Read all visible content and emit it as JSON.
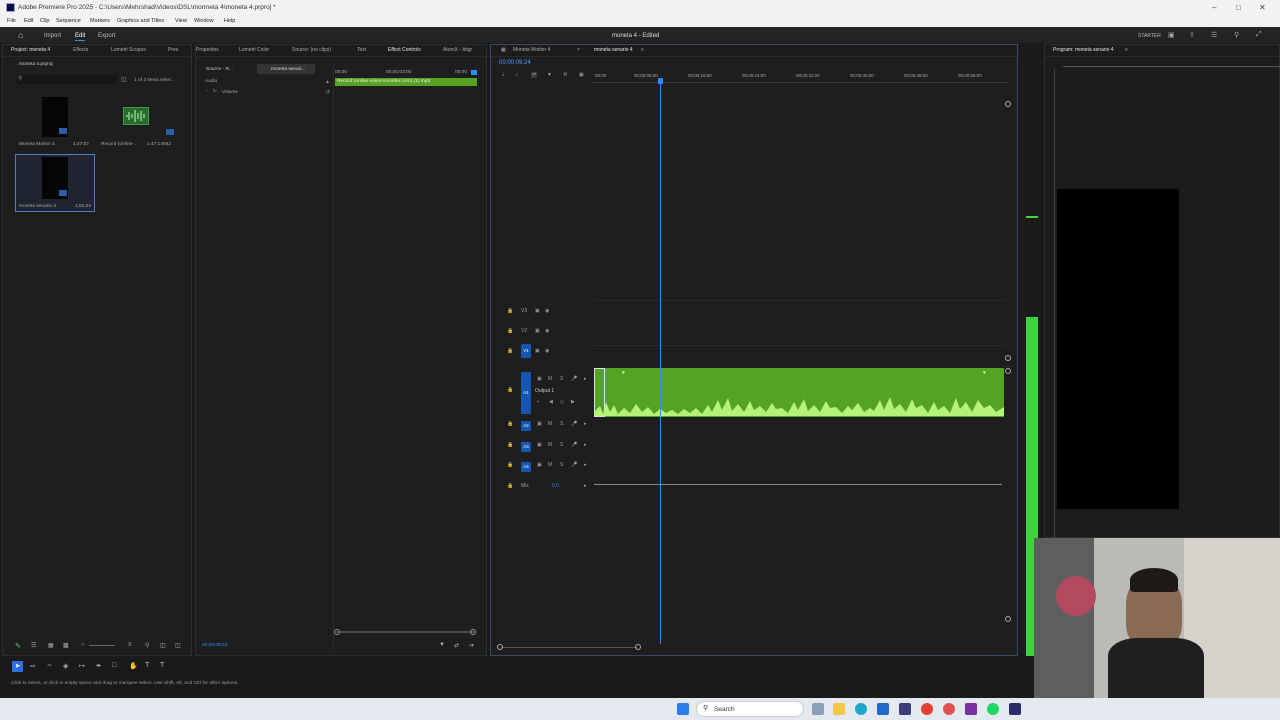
{
  "window": {
    "title": "Adobe Premiere Pro 2025 - C:\\Users\\Mehrshad\\Videos\\DSL\\mormeta 4\\moneta 4.prproj *"
  },
  "menu": [
    "File",
    "Edit",
    "Clip",
    "Sequence",
    "Markers",
    "Graphics and Titles",
    "View",
    "Window",
    "Help"
  ],
  "workspace": {
    "tabs": [
      "Import",
      "Edit",
      "Export"
    ],
    "active": "Edit",
    "center_title": "moneta 4 - Edited",
    "starter": "STARTER"
  },
  "project": {
    "tab": "Project: moneta 4",
    "other_tabs": [
      "Effects",
      "Lumetri Scopes",
      "Pres"
    ],
    "filename": "moneta 4.prproj",
    "count": "1 of 3 items selec..",
    "items": [
      {
        "name": "Moneta Motion 4",
        "duration": "1;47;07"
      },
      {
        "name": "Record (online-...",
        "duration": "1:47:14592"
      },
      {
        "name": "moneta senario 4",
        "duration": "1;52;22"
      }
    ]
  },
  "effects": {
    "tabs": [
      "Properties",
      "Lumetri Color",
      "Source: (no clips)",
      "Text",
      "Effect Controls",
      "AtomX - bitgr"
    ],
    "active_tab": "Effect Controls",
    "source_label": "Source - R...",
    "seq_label": "moneta senari...",
    "section": "Audio",
    "prop": "Volume",
    "ruler_start": "00;00",
    "ruler_mid": "00;00;03;00",
    "ruler_end": "00;00",
    "clip_name": "Record (online-voice-recorder.com) (1).mp3",
    "timecode": "00;00;09;24"
  },
  "timeline": {
    "tabs": [
      "Moneta Motion 4",
      "moneta senario 4"
    ],
    "active_tab": "moneta senario 4",
    "timecode": "00;00;09;24",
    "ruler": [
      "00;00",
      "00;00;08;00",
      "00;00;16;00",
      "00;00;24;00",
      "00;00;32;00",
      "00;00;40;00",
      "00;00;48;00",
      "00;00;56;00"
    ],
    "video_tracks": [
      "V3",
      "V2",
      "V1"
    ],
    "audio_tracks": [
      "A1",
      "A2",
      "A3",
      "A4"
    ],
    "a1_label": "Output 1",
    "mix_label": "Mix",
    "mix_value": "0.0",
    "playhead_fraction": 0.158
  },
  "program": {
    "tab": "Program: moneta senario 4"
  },
  "status": {
    "text": "Click to select, or click in empty space and drag to marquee select. Use Shift, Alt, and Ctrl for other options."
  },
  "taskbar": {
    "search": "Search"
  },
  "colors": {
    "accent": "#2d8cff",
    "clip": "#55a322",
    "wave": "#a8f065",
    "track_label": "#1557b0",
    "vu": "#3fd23f"
  }
}
